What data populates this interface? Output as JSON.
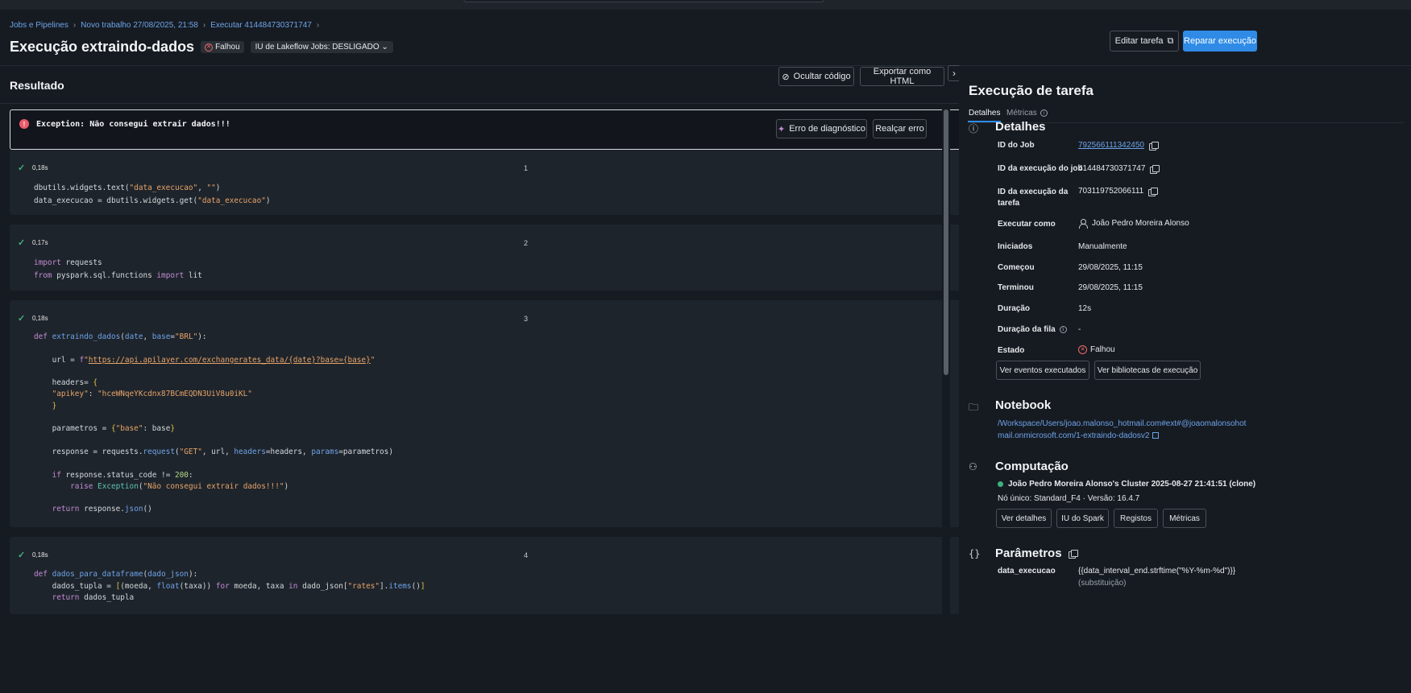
{
  "breadcrumb": [
    "Jobs e Pipelines",
    "Novo trabalho 27/08/2025, 21:58",
    "Executar 414484730371747"
  ],
  "header": {
    "title": "Execução extraindo-dados",
    "status": "Falhou",
    "ui_toggle": "IU de Lakeflow Jobs: DESLIGADO",
    "edit_button": "Editar tarefa",
    "repair_button": "Reparar execução"
  },
  "result": {
    "title": "Resultado",
    "hide_code": "Ocultar código",
    "export_html": "Exportar como HTML"
  },
  "error": {
    "message": "Exception: Não consegui extrair dados!!!",
    "diagnose_button": "Erro de diagnóstico",
    "highlight_button": "Realçar erro"
  },
  "cells": [
    {
      "time": "0,18s",
      "number": "1"
    },
    {
      "time": "0,17s",
      "number": "2"
    },
    {
      "time": "0,18s",
      "number": "3"
    },
    {
      "time": "0,18s",
      "number": "4"
    }
  ],
  "right_panel": {
    "title": "Execução de tarefa",
    "tab_details": "Detalhes",
    "tab_metrics": "Métricas",
    "details": {
      "section_title": "Detalhes",
      "job_id_label": "ID do Job",
      "job_id": "792566111342450",
      "run_id_label": "ID da execução do job",
      "run_id": "414484730371747",
      "task_run_id_label": "ID da execução da tarefa",
      "task_run_id": "703119752066111",
      "run_as_label": "Executar como",
      "run_as": "João Pedro Moreira Alonso",
      "triggered_label": "Iniciados",
      "triggered": "Manualmente",
      "started_label": "Começou",
      "started": "29/08/2025, 11:15",
      "ended_label": "Terminou",
      "ended": "29/08/2025, 11:15",
      "duration_label": "Duração",
      "duration": "12s",
      "queue_label": "Duração da fila",
      "queue": "-",
      "state_label": "Estado",
      "state": "Falhou",
      "events_button": "Ver eventos executados",
      "libs_button": "Ver bibliotecas de execução"
    },
    "notebook": {
      "section_title": "Notebook",
      "path": "/Workspace/Users/joao.malonso_hotmail.com#ext#@joaomalonsohotmail.onmicrosoft.com/1-extraindo-dadosv2"
    },
    "compute": {
      "section_title": "Computação",
      "cluster": "João Pedro Moreira Alonso's Cluster 2025-08-27 21:41:51 (clone)",
      "info": "Nó único: Standard_F4 · Versão: 16.4.7",
      "btn_details": "Ver detalhes",
      "btn_spark": "IU do Spark",
      "btn_logs": "Registos",
      "btn_metrics": "Métricas"
    },
    "params": {
      "section_title": "Parâmetros",
      "name": "data_execucao",
      "value": "{{data_interval_end.strftime(\"%Y-%m-%d\")}}",
      "note": "(substituição)"
    }
  },
  "colors": {
    "accent": "#2f8be6",
    "error": "#ea5b6c",
    "success": "#3fb27f"
  }
}
